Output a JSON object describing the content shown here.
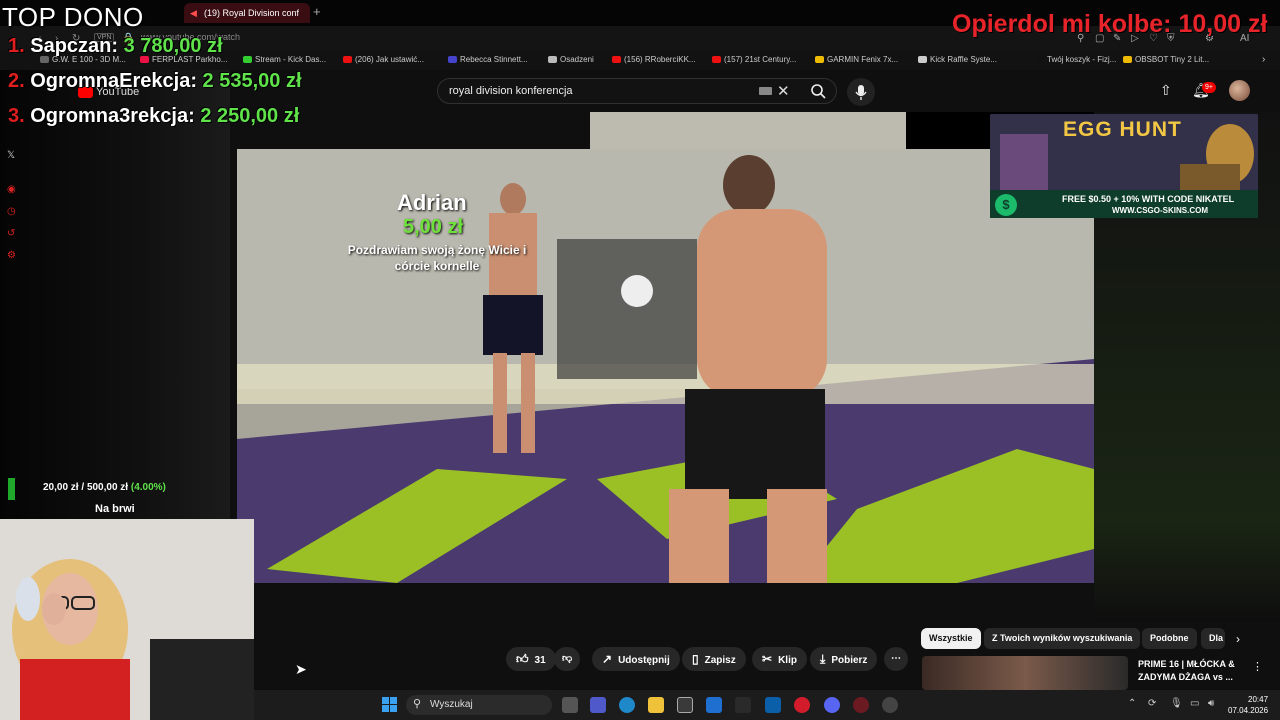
{
  "browser": {
    "tab_title": "(19) Royal Division conf",
    "url": "www.youtube.com/watch",
    "vpn": "VPN",
    "bookmarks": [
      {
        "label": "G.W. E 100 - 3D M...",
        "color": "#666"
      },
      {
        "label": "FERPLAST Parkho...",
        "color": "#e14"
      },
      {
        "label": "Stream - Kick Das...",
        "color": "#3c3"
      },
      {
        "label": "(206) Jak ustawić...",
        "color": "#e11"
      },
      {
        "label": "Rebecca Stinnett...",
        "color": "#44c"
      },
      {
        "label": "Osadzeni",
        "color": "#bbb"
      },
      {
        "label": "(156) RRoberciKK...",
        "color": "#e11"
      },
      {
        "label": "(157) 21st Century...",
        "color": "#e11"
      },
      {
        "label": "GARMIN Fenix 7x...",
        "color": "#eb0"
      },
      {
        "label": "Kick Raffle Syste...",
        "color": "#ccc"
      },
      {
        "label": "Twój koszyk - Fizj...",
        "color": "#111"
      },
      {
        "label": "OBSBOT Tiny 2 Lit...",
        "color": "#eb0"
      }
    ]
  },
  "youtube": {
    "logo_text": "YouTube",
    "search_value": "royal division konferencja",
    "notifications_badge": "9+",
    "actions": {
      "like_count": "31",
      "share": "Udostępnij",
      "save": "Zapisz",
      "clip": "Klip",
      "download": "Pobierz"
    },
    "chips": [
      "Wszystkie",
      "Z Twoich wyników wyszukiwania",
      "Podobne",
      "Dla"
    ],
    "recommendation_title": "PRIME 16 | MŁÓCKA & ZADYMA DŻAGA vs ..."
  },
  "ad": {
    "title": "EGG HUNT",
    "line1": "FREE $0.50 + 10% WITH CODE NIKATEL",
    "line2": "WWW.CSGO-SKINS.COM",
    "coin": "$"
  },
  "stream_overlay": {
    "top_dono": "TOP DONO",
    "leaderboard": [
      {
        "rank": "1.",
        "name": "Sapczan:",
        "amount": "3 780,00 zł"
      },
      {
        "rank": "2.",
        "name": "OgromnaErekcja:",
        "amount": "2 535,00 zł"
      },
      {
        "rank": "3.",
        "name": "Ogromna3rekcja:",
        "amount": "2 250,00 zł"
      }
    ],
    "latest_donation": {
      "label": "Opierdol mi kolbe",
      "amount": "10,00 zł"
    },
    "alert": {
      "name": "Adrian",
      "amount": "5,00 zł",
      "message": "Pozdrawiam swoją żonę Wicie i córcie kornelle"
    },
    "goal": {
      "current": "20,00 zł",
      "separator": "/",
      "target": "500,00 zł",
      "percent": "(4.00%)",
      "fraction": 0.04,
      "label": "Na brwi"
    }
  },
  "taskbar": {
    "search_placeholder": "Wyszukaj",
    "time": "20:47",
    "date": "07.04.2026"
  }
}
